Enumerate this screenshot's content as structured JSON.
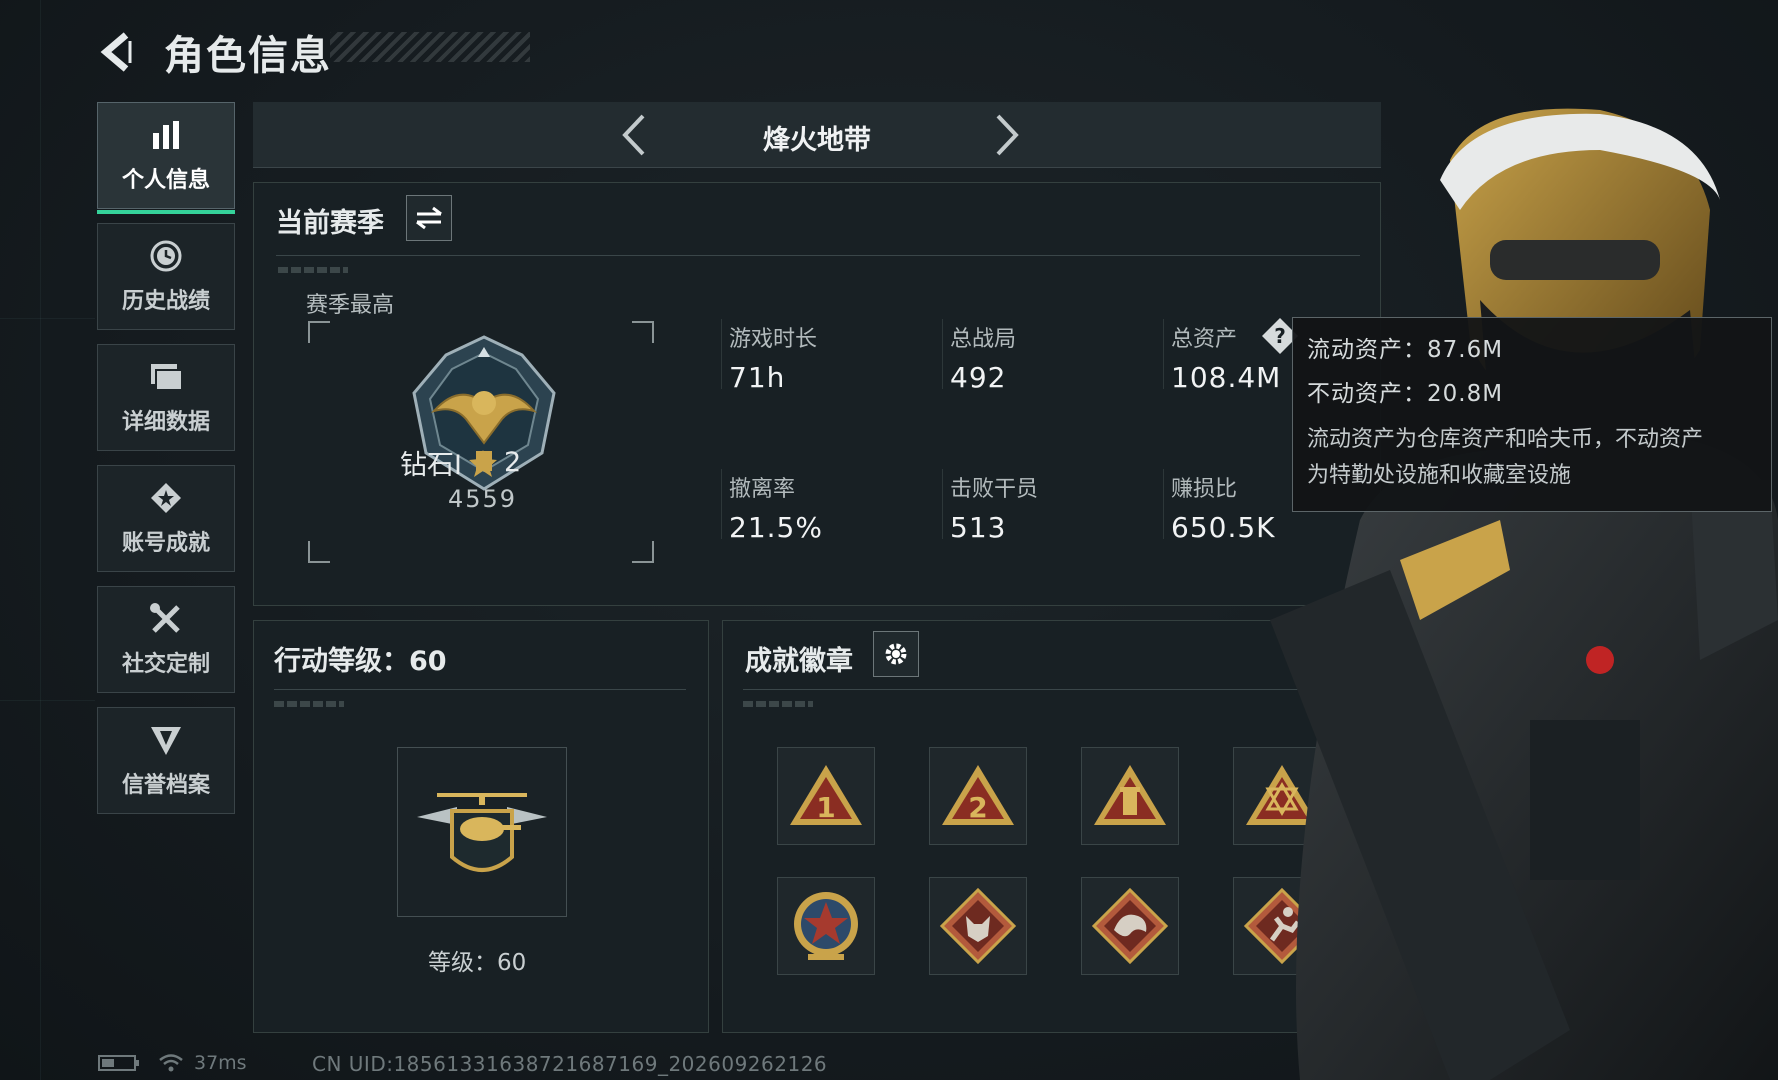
{
  "header": {
    "title": "角色信息"
  },
  "sidebar": {
    "items": [
      {
        "label": "个人信息",
        "icon": "bar-chart-icon",
        "active": true
      },
      {
        "label": "历史战绩",
        "icon": "history-clock-icon",
        "active": false
      },
      {
        "label": "详细数据",
        "icon": "data-cards-icon",
        "active": false
      },
      {
        "label": "账号成就",
        "icon": "achievement-star-icon",
        "active": false
      },
      {
        "label": "社交定制",
        "icon": "tools-icon",
        "active": false
      },
      {
        "label": "信誉档案",
        "icon": "shield-emblem-icon",
        "active": false
      }
    ]
  },
  "mode": {
    "title": "烽火地带"
  },
  "season": {
    "title": "当前赛季",
    "best_label": "赛季最高",
    "rank_name": "钻石I",
    "rank_stars": "2",
    "rank_score": "4559",
    "stats": [
      {
        "label": "游戏时长",
        "value": "71h"
      },
      {
        "label": "总战局",
        "value": "492"
      },
      {
        "label": "总资产",
        "value": "108.4M"
      },
      {
        "label": "撤离率",
        "value": "21.5%"
      },
      {
        "label": "击败干员",
        "value": "513"
      },
      {
        "label": "赚损比",
        "value": "650.5K"
      }
    ]
  },
  "tooltip": {
    "liquid": "流动资产：87.6M",
    "fixed": "不动资产：20.8M",
    "desc_line1": "流动资产为仓库资产和哈夫币，不动资产",
    "desc_line2": "为特勤处设施和收藏室设施"
  },
  "level": {
    "title": "行动等级：60",
    "caption": "等级：60"
  },
  "badges": {
    "title": "成就徽章",
    "items": [
      "triangle-1-badge-icon",
      "triangle-2-badge-icon",
      "triangle-tower-badge-icon",
      "triangle-emblem-badge-icon",
      "star-medal-badge-icon",
      "wolf-diamond-badge-icon",
      "dragon-diamond-badge-icon",
      "runner-diamond-badge-icon"
    ]
  },
  "footer": {
    "ping": "37ms",
    "uid": "CN UID:18561331638721687169_202609262126"
  },
  "colors": {
    "accent": "#35d29a",
    "gold": "#c9a34a",
    "badge_red": "#8a2d22"
  }
}
